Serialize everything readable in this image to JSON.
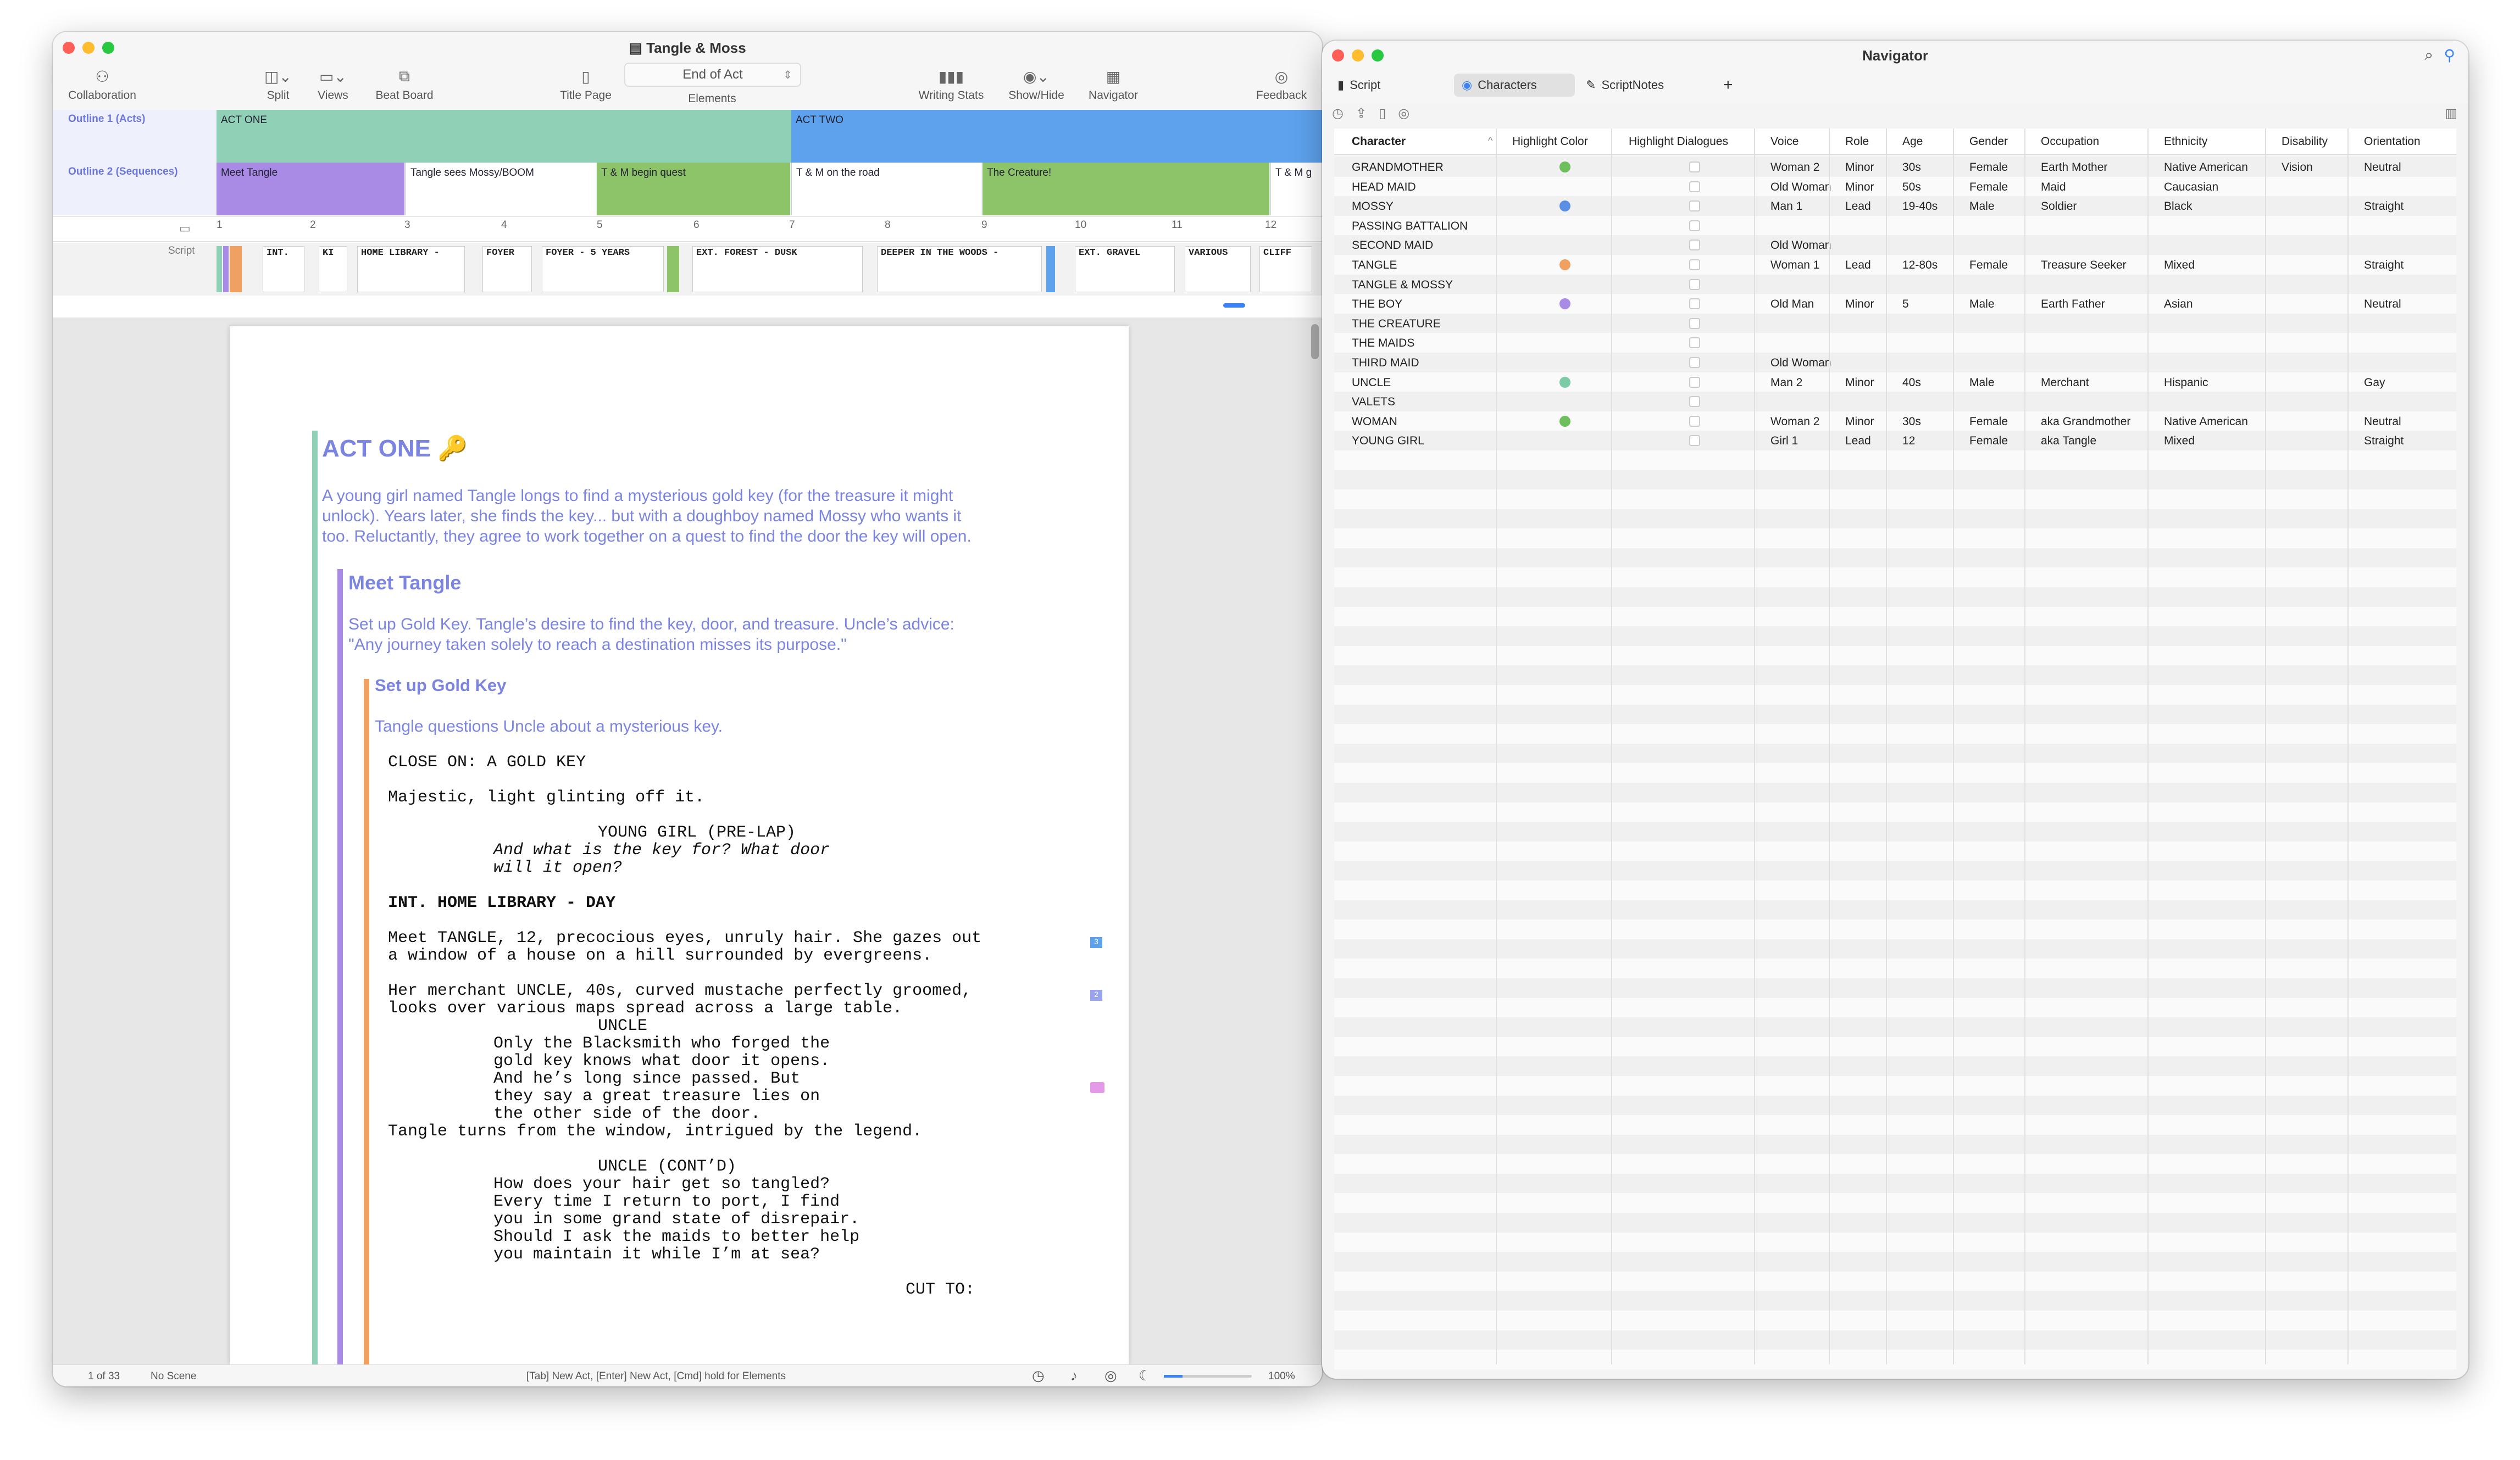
{
  "editor": {
    "title": "Tangle & Moss",
    "toolbar": {
      "collaboration": "Collaboration",
      "split": "Split",
      "views": "Views",
      "beat_board": "Beat Board",
      "title_page": "Title Page",
      "elements": "Elements",
      "elements_value": "End of Act",
      "writing_stats": "Writing Stats",
      "show_hide": "Show/Hide",
      "navigator": "Navigator",
      "feedback": "Feedback"
    },
    "outline1": {
      "label": "Outline 1 (Acts)",
      "segments": [
        "ACT ONE",
        "ACT TWO"
      ]
    },
    "outline2": {
      "label": "Outline 2 (Sequences)",
      "segments": [
        "Meet Tangle",
        "Tangle sees Mossy/BOOM",
        "T & M begin quest",
        "T & M on the road",
        "The Creature!",
        "T & M g"
      ]
    },
    "ruler": [
      "1",
      "2",
      "3",
      "4",
      "5",
      "6",
      "7",
      "8",
      "9",
      "10",
      "11",
      "12"
    ],
    "script_label": "Script",
    "script_cards": [
      "INT.",
      "KI",
      "HOME LIBRARY -",
      "FOYER",
      "FOYER - 5 YEARS",
      "EXT. FOREST - DUSK",
      "DEEPER IN THE WOODS -",
      "EXT. GRAVEL",
      "VARIOUS",
      "CLIFF"
    ],
    "doc": {
      "act_title": "ACT ONE 🔑",
      "act_summary": [
        "A young girl named Tangle longs to find a mysterious gold key (for the treasure it might",
        "unlock). Years later, she finds the key... but with a doughboy named Mossy who wants it",
        "too. Reluctantly, they agree to work together on a quest to find the door the key will open."
      ],
      "seq_title": "Meet Tangle",
      "seq_summary": [
        "Set up Gold Key. Tangle’s desire to find the key, door, and treasure. Uncle’s advice:",
        "\"Any journey taken solely to reach a destination misses its purpose.\""
      ],
      "scene_title": "Set up Gold Key",
      "scene_summary": "Tangle questions Uncle about a mysterious key.",
      "lines": [
        "CLOSE ON: A GOLD KEY",
        "Majestic, light glinting off it.",
        "YOUNG GIRL (PRE-LAP)",
        "And what is the key for? What door\nwill it open?",
        "INT. HOME LIBRARY - DAY",
        "Meet TANGLE, 12, precocious eyes, unruly hair. She gazes out\na window of a house on a hill surrounded by evergreens.",
        "Her merchant UNCLE, 40s, curved mustache perfectly groomed,\nlooks over various maps spread across a large table.",
        "UNCLE",
        "Only the Blacksmith who forged the\ngold key knows what door it opens.\nAnd he’s long since passed. But\nthey say a great treasure lies on\nthe other side of the door.",
        "Tangle turns from the window, intrigued by the legend.",
        "UNCLE (CONT’D)",
        "How does your hair get so tangled?\nEvery time I return to port, I find\nyou in some grand state of disrepair.\nShould I ask the maids to better help\nyou maintain it while I’m at sea?",
        "CUT TO:"
      ],
      "notes": [
        "3",
        "2"
      ]
    },
    "status": {
      "page": "1 of 33",
      "scene": "No Scene",
      "hint": "[Tab] New Act, [Enter] New Act, [Cmd] hold for Elements",
      "zoom": "100%"
    }
  },
  "navigator": {
    "title": "Navigator",
    "tabs": [
      "Script",
      "Characters",
      "ScriptNotes"
    ],
    "add": "+",
    "columns": [
      "Character",
      "Highlight Color",
      "Highlight Dialogues",
      "Voice",
      "Role",
      "Age",
      "Gender",
      "Occupation",
      "Ethnicity",
      "Disability",
      "Orientation"
    ],
    "rows": [
      {
        "name": "GRANDMOTHER",
        "color": "#6cbf5c",
        "voice": "Woman 2",
        "role": "Minor",
        "age": "30s",
        "gender": "Female",
        "occupation": "Earth Mother",
        "ethnicity": "Native American",
        "disability": "Vision",
        "orientation": "Neutral"
      },
      {
        "name": "HEAD MAID",
        "color": "",
        "voice": "Old Woman",
        "role": "Minor",
        "age": "50s",
        "gender": "Female",
        "occupation": "Maid",
        "ethnicity": "Caucasian",
        "disability": "",
        "orientation": ""
      },
      {
        "name": "MOSSY",
        "color": "#5b8fe6",
        "voice": "Man 1",
        "role": "Lead",
        "age": "19-40s",
        "gender": "Male",
        "occupation": "Soldier",
        "ethnicity": "Black",
        "disability": "",
        "orientation": "Straight"
      },
      {
        "name": "PASSING BATTALION",
        "color": "",
        "voice": "",
        "role": "",
        "age": "",
        "gender": "",
        "occupation": "",
        "ethnicity": "",
        "disability": "",
        "orientation": ""
      },
      {
        "name": "SECOND MAID",
        "color": "",
        "voice": "Old Woman",
        "role": "",
        "age": "",
        "gender": "",
        "occupation": "",
        "ethnicity": "",
        "disability": "",
        "orientation": ""
      },
      {
        "name": "TANGLE",
        "color": "#f0a060",
        "voice": "Woman 1",
        "role": "Lead",
        "age": "12-80s",
        "gender": "Female",
        "occupation": "Treasure Seeker",
        "ethnicity": "Mixed",
        "disability": "",
        "orientation": "Straight"
      },
      {
        "name": "TANGLE & MOSSY",
        "color": "",
        "voice": "",
        "role": "",
        "age": "",
        "gender": "",
        "occupation": "",
        "ethnicity": "",
        "disability": "",
        "orientation": ""
      },
      {
        "name": "THE BOY",
        "color": "#a98be6",
        "voice": "Old Man",
        "role": "Minor",
        "age": "5",
        "gender": "Male",
        "occupation": "Earth Father",
        "ethnicity": "Asian",
        "disability": "",
        "orientation": "Neutral"
      },
      {
        "name": "THE CREATURE",
        "color": "",
        "voice": "",
        "role": "",
        "age": "",
        "gender": "",
        "occupation": "",
        "ethnicity": "",
        "disability": "",
        "orientation": ""
      },
      {
        "name": "THE MAIDS",
        "color": "",
        "voice": "",
        "role": "",
        "age": "",
        "gender": "",
        "occupation": "",
        "ethnicity": "",
        "disability": "",
        "orientation": ""
      },
      {
        "name": "THIRD MAID",
        "color": "",
        "voice": "Old Woman",
        "role": "",
        "age": "",
        "gender": "",
        "occupation": "",
        "ethnicity": "",
        "disability": "",
        "orientation": ""
      },
      {
        "name": "UNCLE",
        "color": "#7ccaa6",
        "voice": "Man 2",
        "role": "Minor",
        "age": "40s",
        "gender": "Male",
        "occupation": "Merchant",
        "ethnicity": "Hispanic",
        "disability": "",
        "orientation": "Gay"
      },
      {
        "name": "VALETS",
        "color": "",
        "voice": "",
        "role": "",
        "age": "",
        "gender": "",
        "occupation": "",
        "ethnicity": "",
        "disability": "",
        "orientation": ""
      },
      {
        "name": "WOMAN",
        "color": "#6cbf5c",
        "voice": "Woman 2",
        "role": "Minor",
        "age": "30s",
        "gender": "Female",
        "occupation": "aka Grandmother",
        "ethnicity": "Native American",
        "disability": "",
        "orientation": "Neutral"
      },
      {
        "name": "YOUNG GIRL",
        "color": "",
        "voice": "Girl 1",
        "role": "Lead",
        "age": "12",
        "gender": "Female",
        "occupation": "aka Tangle",
        "ethnicity": "Mixed",
        "disability": "",
        "orientation": "Straight"
      }
    ]
  },
  "colors": {
    "act_one": "#8fd0b6",
    "act_two": "#5ea2ee",
    "meet_tangle": "#a98be6",
    "begin_quest": "#8dc46a",
    "creature": "#8dc46a",
    "outline_text": "#7b84e0"
  }
}
